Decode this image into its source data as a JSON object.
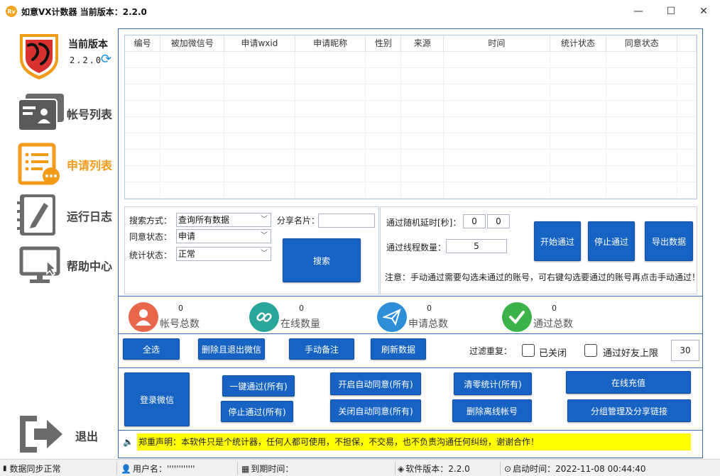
{
  "window": {
    "title": "如意VX计数器 当前版本：2.2.0",
    "logo_text": "Rv",
    "minimize": "—",
    "maximize": "☐",
    "close": "✕"
  },
  "sidebar": {
    "version_title": "当前版本",
    "version_number": "2.2.0",
    "items": [
      {
        "label": "帐号列表",
        "icon": "account-list-icon"
      },
      {
        "label": "申请列表",
        "icon": "request-list-icon"
      },
      {
        "label": "运行日志",
        "icon": "log-icon"
      },
      {
        "label": "帮助中心",
        "icon": "help-center-icon"
      }
    ],
    "exit_label": "退出"
  },
  "grid": {
    "columns": [
      "编号",
      "被加微信号",
      "申请wxid",
      "申请昵称",
      "性别",
      "来源",
      "时间",
      "统计状态",
      "同意状态"
    ]
  },
  "search": {
    "mode_label": "搜索方式：",
    "mode_value": "查询所有数据",
    "agree_label": "同意状态：",
    "agree_value": "申请",
    "stat_label": "统计状态：",
    "stat_value": "正常",
    "share_label": "分享名片：",
    "share_value": "",
    "search_button": "搜索"
  },
  "thread": {
    "delay_label": "通过随机延时[秒]：",
    "delay_min": "0",
    "delay_max": "0",
    "count_label": "通过线程数量：",
    "count_value": "5",
    "start_button": "开始通过",
    "stop_button": "停止通过",
    "export_button": "导出数据",
    "note": "注意：手动通过需要勾选未通过的账号，可右键勾选要通过的账号再点击手动通过！"
  },
  "stats": [
    {
      "value": "0",
      "label": "帐号总数",
      "color": "#e8674a"
    },
    {
      "value": "0",
      "label": "在线数量",
      "color": "#2aa59a"
    },
    {
      "value": "0",
      "label": "申请总数",
      "color": "#2e8fd8"
    },
    {
      "value": "0",
      "label": "通过总数",
      "color": "#3bb24a"
    }
  ],
  "actions": {
    "select_all": "全选",
    "delete_exit": "删除且退出微信",
    "manual_note": "手动备注",
    "refresh": "刷新数据",
    "filter_label": "过滤重复：",
    "closed_label": "已关闭",
    "friend_limit_label": "通过好友上限",
    "friend_limit_value": "30"
  },
  "bottom": {
    "login": "登录微信",
    "pass_all": "一键通过(所有)",
    "stop_all": "停止通过(所有)",
    "auto_on": "开启自动同意(所有)",
    "auto_off": "关闭自动同意(所有)",
    "clear_stats": "清零统计(所有)",
    "delete_offline": "删除离线帐号",
    "recharge": "在线充值",
    "group_share": "分组管理及分享链接"
  },
  "disclaimer": "郑重声明：本软件只是个统计器，任何人都可使用，不担保，不交易，也不负责沟通任何纠纷，谢谢合作！",
  "status": {
    "sync": "数据同步正常",
    "user_label": "用户名：",
    "user_value": "''''''''''''",
    "expire_label": "到期时间：",
    "version_label": "软件版本：",
    "version_value": "2.2.0",
    "start_label": "启动时间：",
    "start_value": "2022-11-08 00:44:40"
  }
}
